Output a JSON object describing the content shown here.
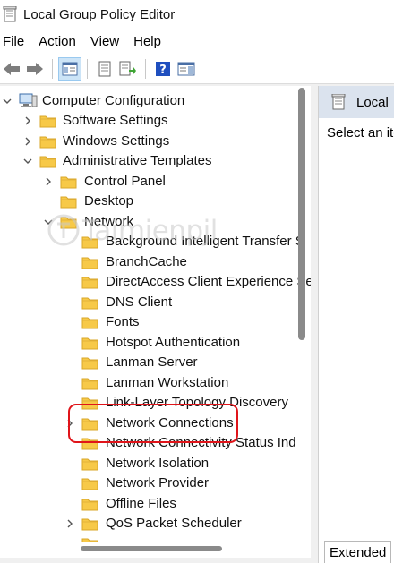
{
  "window": {
    "title": "Local Group Policy Editor",
    "icon": "policy-document-icon"
  },
  "menu": [
    "File",
    "Action",
    "View",
    "Help"
  ],
  "toolbar": {
    "buttons": [
      "back-arrow-icon",
      "forward-arrow-icon",
      "show-tree-icon",
      "properties-icon",
      "export-list-icon",
      "help-icon",
      "show-hide-pane-icon"
    ]
  },
  "tree": {
    "root": "Computer Configuration",
    "items": [
      {
        "label": "Software Settings"
      },
      {
        "label": "Windows Settings"
      },
      {
        "label": "Administrative Templates"
      },
      {
        "label": "Control Panel"
      },
      {
        "label": "Desktop"
      },
      {
        "label": "Network"
      },
      {
        "label": "Background Intelligent Transfer S"
      },
      {
        "label": "BranchCache"
      },
      {
        "label": "DirectAccess Client Experience Se"
      },
      {
        "label": "DNS Client"
      },
      {
        "label": "Fonts"
      },
      {
        "label": "Hotspot Authentication"
      },
      {
        "label": "Lanman Server"
      },
      {
        "label": "Lanman Workstation"
      },
      {
        "label": "Link-Layer Topology Discovery"
      },
      {
        "label": "Network Connections"
      },
      {
        "label": "Network Connectivity Status Ind"
      },
      {
        "label": "Network Isolation"
      },
      {
        "label": "Network Provider"
      },
      {
        "label": "Offline Files"
      },
      {
        "label": "QoS Packet Scheduler"
      }
    ]
  },
  "right_pane": {
    "header": "Local",
    "body": "Select an ite",
    "tab": "Extended"
  },
  "colors": {
    "highlight": "#e0141a",
    "folder": "#f7c948",
    "header_bg": "#dbe3ee"
  }
}
